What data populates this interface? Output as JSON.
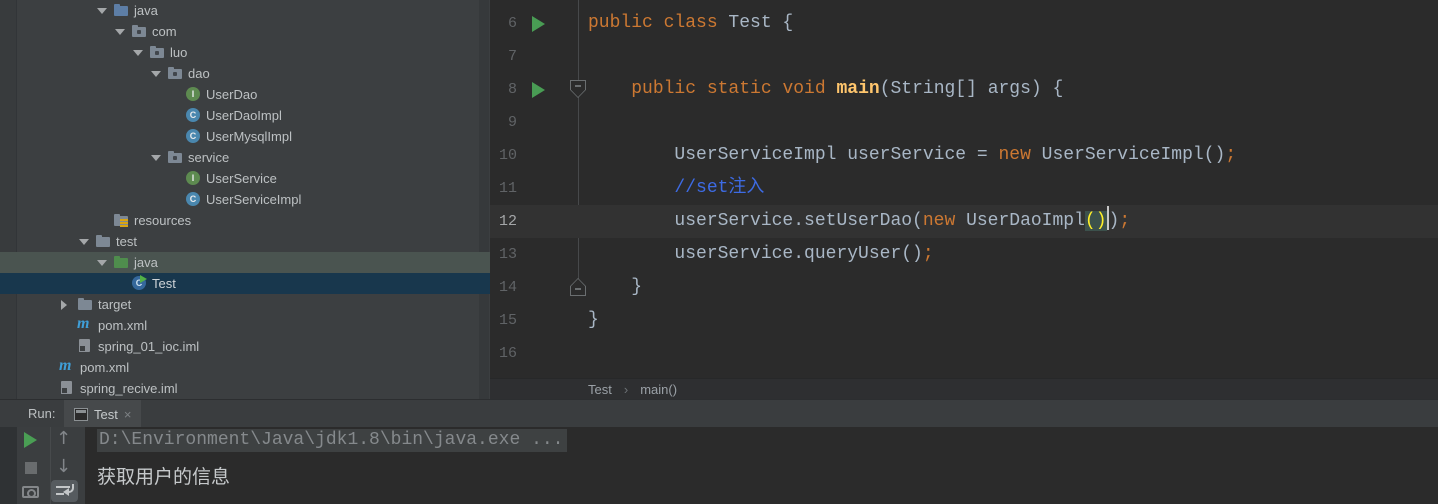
{
  "colors": {
    "panel_bg": "#3c3f41",
    "editor_bg": "#2b2b2b",
    "keyword_orange": "#cc7832",
    "method_yellow": "#ffc66d",
    "comment_blue": "#3d6be4",
    "matched_paren_yellow": "#ffef28",
    "matched_paren_bg": "#3c514c",
    "tree_selection_blue": "#18374d",
    "tree_hover_green": "#4a5450",
    "run_green": "#4a9e54",
    "current_line_bg": "#323232"
  },
  "project_tree": {
    "icon_letters": {
      "interface": "I",
      "class": "C",
      "class-run": "C",
      "maven": "m"
    },
    "rows": [
      {
        "label": "java",
        "depth": 3,
        "chevron": "down",
        "icon": "folder-source",
        "bg": "none"
      },
      {
        "label": "com",
        "depth": 4,
        "chevron": "down",
        "icon": "package",
        "bg": "none"
      },
      {
        "label": "luo",
        "depth": 5,
        "chevron": "down",
        "icon": "package",
        "bg": "none"
      },
      {
        "label": "dao",
        "depth": 6,
        "chevron": "down",
        "icon": "package",
        "bg": "none"
      },
      {
        "label": "UserDao",
        "depth": 7,
        "chevron": "none",
        "icon": "interface",
        "bg": "none"
      },
      {
        "label": "UserDaoImpl",
        "depth": 7,
        "chevron": "none",
        "icon": "class",
        "bg": "none"
      },
      {
        "label": "UserMysqlImpl",
        "depth": 7,
        "chevron": "none",
        "icon": "class",
        "bg": "none"
      },
      {
        "label": "service",
        "depth": 6,
        "chevron": "down",
        "icon": "package",
        "bg": "none"
      },
      {
        "label": "UserService",
        "depth": 7,
        "chevron": "none",
        "icon": "interface",
        "bg": "none"
      },
      {
        "label": "UserServiceImpl",
        "depth": 7,
        "chevron": "none",
        "icon": "class",
        "bg": "none"
      },
      {
        "label": "resources",
        "depth": 3,
        "chevron": "none",
        "icon": "folder-resources",
        "bg": "none"
      },
      {
        "label": "test",
        "depth": 2,
        "chevron": "down",
        "icon": "folder",
        "bg": "none"
      },
      {
        "label": "java",
        "depth": 3,
        "chevron": "down",
        "icon": "folder-test",
        "bg": "hover"
      },
      {
        "label": "Test",
        "depth": 4,
        "chevron": "none",
        "icon": "class-run",
        "bg": "selected"
      },
      {
        "label": "target",
        "depth": 1,
        "chevron": "right",
        "icon": "folder",
        "bg": "none"
      },
      {
        "label": "pom.xml",
        "depth": 1,
        "chevron": "none",
        "icon": "maven",
        "bg": "none"
      },
      {
        "label": "spring_01_ioc.iml",
        "depth": 1,
        "chevron": "none",
        "icon": "iml",
        "bg": "none"
      },
      {
        "label": "pom.xml",
        "depth": 0,
        "chevron": "none",
        "icon": "maven",
        "bg": "none"
      },
      {
        "label": "spring_recive.iml",
        "depth": 0,
        "chevron": "none",
        "icon": "iml",
        "bg": "none"
      }
    ]
  },
  "editor": {
    "breadcrumb": {
      "class_name": "Test",
      "separator": "›",
      "method": "main()"
    },
    "lines": [
      {
        "num": 6,
        "runnable": true,
        "fold": null,
        "current": false,
        "tokens": [
          [
            "kw",
            "public class"
          ],
          [
            "plain",
            " Test {"
          ]
        ]
      },
      {
        "num": 7,
        "runnable": false,
        "fold": null,
        "current": false,
        "tokens": []
      },
      {
        "num": 8,
        "runnable": true,
        "fold": "start",
        "current": false,
        "tokens": [
          [
            "plain",
            "    "
          ],
          [
            "kw",
            "public static void"
          ],
          [
            "plain",
            " "
          ],
          [
            "method",
            "main"
          ],
          [
            "plain",
            "(String[] args) {"
          ]
        ]
      },
      {
        "num": 9,
        "runnable": false,
        "fold": null,
        "current": false,
        "tokens": []
      },
      {
        "num": 10,
        "runnable": false,
        "fold": null,
        "current": false,
        "tokens": [
          [
            "plain",
            "        UserServiceImpl userService = "
          ],
          [
            "kw",
            "new"
          ],
          [
            "plain",
            " UserServiceImpl()"
          ],
          [
            "semi",
            ";"
          ]
        ]
      },
      {
        "num": 11,
        "runnable": false,
        "fold": null,
        "current": false,
        "tokens": [
          [
            "plain",
            "        "
          ],
          [
            "comment",
            "//set注入"
          ]
        ]
      },
      {
        "num": 12,
        "runnable": false,
        "fold": null,
        "current": true,
        "tokens": [
          [
            "plain",
            "        userService.setUserDao("
          ],
          [
            "kw",
            "new"
          ],
          [
            "plain",
            " UserDaoImpl"
          ],
          [
            "hl",
            "()"
          ],
          [
            "caret",
            ""
          ],
          [
            "plain",
            ")"
          ],
          [
            "semi",
            ";"
          ]
        ]
      },
      {
        "num": 13,
        "runnable": false,
        "fold": null,
        "current": false,
        "tokens": [
          [
            "plain",
            "        userService.queryUser()"
          ],
          [
            "semi",
            ";"
          ]
        ]
      },
      {
        "num": 14,
        "runnable": false,
        "fold": "end",
        "current": false,
        "tokens": [
          [
            "plain",
            "    }"
          ]
        ]
      },
      {
        "num": 15,
        "runnable": false,
        "fold": null,
        "current": false,
        "tokens": [
          [
            "plain",
            "}"
          ]
        ]
      },
      {
        "num": 16,
        "runnable": false,
        "fold": null,
        "current": false,
        "tokens": []
      }
    ]
  },
  "run_panel": {
    "label": "Run:",
    "tab_title": "Test",
    "close": "×",
    "console_lines": [
      "D:\\Environment\\Java\\jdk1.8\\bin\\java.exe ...",
      "获取用户的信息"
    ]
  }
}
